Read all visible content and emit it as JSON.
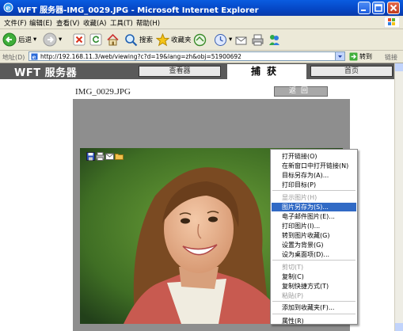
{
  "window": {
    "title": "WFT 服务器-IMG_0029.JPG - Microsoft Internet Explorer",
    "accent": "#0a4fd4"
  },
  "menubar": {
    "items": [
      "文件(F)",
      "编辑(E)",
      "查看(V)",
      "收藏(A)",
      "工具(T)",
      "帮助(H)"
    ]
  },
  "toolbar": {
    "back_label": "后退",
    "search_label": "搜索",
    "favorites_label": "收藏夹"
  },
  "address": {
    "label": "地址(D)",
    "url": "http://192.168.11.3/web/viewing?c?d=19&lang=zh&obj=51900692",
    "go_label": "转到",
    "links_label": "链接"
  },
  "wft": {
    "brand": "WFT 服务器",
    "tabs": [
      {
        "label": "查看器",
        "active": false
      },
      {
        "label": "捕获",
        "active": true
      },
      {
        "label": "首页",
        "active": false
      }
    ],
    "image_name": "IMG_0029.JPG",
    "back_button": "返回"
  },
  "context_menu": {
    "items": [
      {
        "label": "打开链接(O)",
        "enabled": true
      },
      {
        "label": "在新窗口中打开链接(N)",
        "enabled": true
      },
      {
        "label": "目标另存为(A)...",
        "enabled": true
      },
      {
        "label": "打印目标(P)",
        "enabled": true
      },
      {
        "separator": true
      },
      {
        "label": "显示图片(H)",
        "enabled": false
      },
      {
        "label": "图片另存为(S)...",
        "enabled": true,
        "highlighted": true
      },
      {
        "label": "电子邮件图片(E)...",
        "enabled": true
      },
      {
        "label": "打印图片(I)...",
        "enabled": true
      },
      {
        "label": "转到图片收藏(G)",
        "enabled": true
      },
      {
        "label": "设置为背景(G)",
        "enabled": true
      },
      {
        "label": "设为桌面项(D)...",
        "enabled": true
      },
      {
        "separator": true
      },
      {
        "label": "剪切(T)",
        "enabled": false
      },
      {
        "label": "复制(C)",
        "enabled": true
      },
      {
        "label": "复制快捷方式(T)",
        "enabled": true
      },
      {
        "label": "粘贴(P)",
        "enabled": false
      },
      {
        "separator": true
      },
      {
        "label": "添加到收藏夹(F)...",
        "enabled": true
      },
      {
        "separator": true
      },
      {
        "label": "属性(R)",
        "enabled": true
      }
    ]
  }
}
